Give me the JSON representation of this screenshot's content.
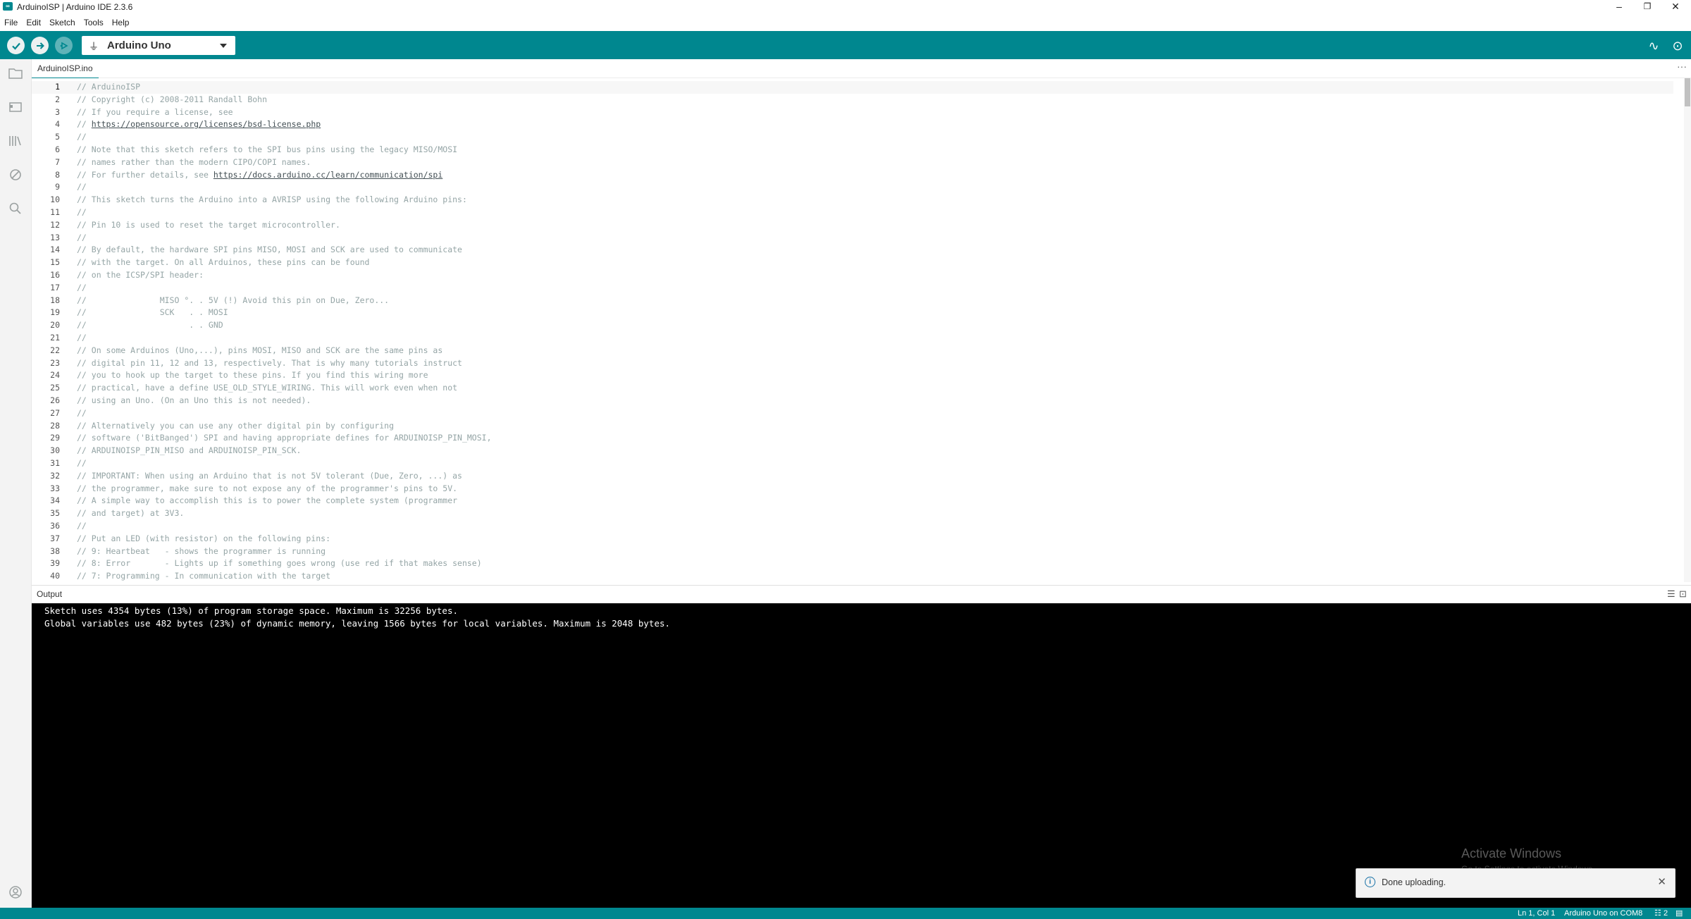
{
  "window": {
    "title": "ArduinoISP | Arduino IDE 2.3.6",
    "app_icon_text": "∞",
    "minimize": "–",
    "restore": "❐",
    "close": "✕"
  },
  "menu": [
    "File",
    "Edit",
    "Sketch",
    "Tools",
    "Help"
  ],
  "toolbar": {
    "verify_icon": "check-icon",
    "upload_icon": "arrow-right-icon",
    "debug_icon": "debug-icon",
    "board_name": "Arduino Uno",
    "usb_icon": "⏚",
    "serial_plotter_icon": "∿",
    "serial_monitor_icon": "⊙",
    "accent_color": "#00878f"
  },
  "tab": {
    "label": "ArduinoISP.ino",
    "more": "···"
  },
  "editor": {
    "lines": [
      "// ArduinoISP",
      "// Copyright (c) 2008-2011 Randall Bohn",
      "// If you require a license, see",
      "// https://opensource.org/licenses/bsd-license.php",
      "//",
      "// Note that this sketch refers to the SPI bus pins using the legacy MISO/MOSI",
      "// names rather than the modern CIPO/COPI names.",
      "// For further details, see https://docs.arduino.cc/learn/communication/spi",
      "//",
      "// This sketch turns the Arduino into a AVRISP using the following Arduino pins:",
      "//",
      "// Pin 10 is used to reset the target microcontroller.",
      "//",
      "// By default, the hardware SPI pins MISO, MOSI and SCK are used to communicate",
      "// with the target. On all Arduinos, these pins can be found",
      "// on the ICSP/SPI header:",
      "//",
      "//               MISO °. . 5V (!) Avoid this pin on Due, Zero...",
      "//               SCK   . . MOSI",
      "//                     . . GND",
      "//",
      "// On some Arduinos (Uno,...), pins MOSI, MISO and SCK are the same pins as",
      "// digital pin 11, 12 and 13, respectively. That is why many tutorials instruct",
      "// you to hook up the target to these pins. If you find this wiring more",
      "// practical, have a define USE_OLD_STYLE_WIRING. This will work even when not",
      "// using an Uno. (On an Uno this is not needed).",
      "//",
      "// Alternatively you can use any other digital pin by configuring",
      "// software ('BitBanged') SPI and having appropriate defines for ARDUINOISP_PIN_MOSI,",
      "// ARDUINOISP_PIN_MISO and ARDUINOISP_PIN_SCK.",
      "//",
      "// IMPORTANT: When using an Arduino that is not 5V tolerant (Due, Zero, ...) as",
      "// the programmer, make sure to not expose any of the programmer's pins to 5V.",
      "// A simple way to accomplish this is to power the complete system (programmer",
      "// and target) at 3V3.",
      "//",
      "// Put an LED (with resistor) on the following pins:",
      "// 9: Heartbeat   - shows the programmer is running",
      "// 8: Error       - Lights up if something goes wrong (use red if that makes sense)",
      "// 7: Programming - In communication with the target"
    ]
  },
  "output": {
    "label": "Output",
    "lines": [
      "Sketch uses 4354 bytes (13%) of program storage space. Maximum is 32256 bytes.",
      "Global variables use 482 bytes (23%) of dynamic memory, leaving 1566 bytes for local variables. Maximum is 2048 bytes."
    ]
  },
  "watermark": {
    "title": "Activate Windows",
    "subtitle": "Go to Settings to activate Windows."
  },
  "toast": {
    "message": "Done uploading.",
    "close": "✕"
  },
  "statusbar": {
    "position": "Ln 1, Col 1",
    "board": "Arduino Uno on COM8",
    "notifications": "2"
  }
}
